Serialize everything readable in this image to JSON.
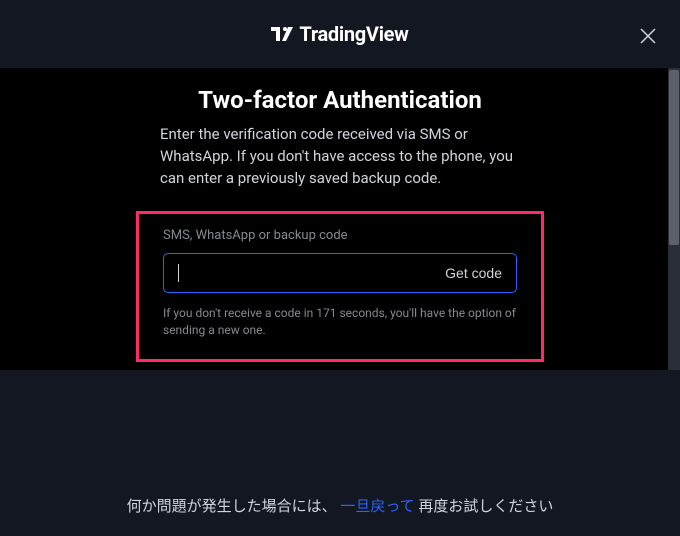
{
  "header": {
    "brand_name": "TradingView"
  },
  "dialog": {
    "title": "Two-factor Authentication",
    "description": "Enter the verification code received via SMS or WhatsApp. If you don't have access to the phone, you can enter a previously saved backup code.",
    "input_label": "SMS, WhatsApp or backup code",
    "input_value": "",
    "get_code_label": "Get code",
    "hint": "If you don't receive a code in 171 seconds, you'll have the option of sending a new one."
  },
  "footer": {
    "prefix": "何か問題が発生した場合には、",
    "link": "一旦戻って",
    "suffix": "再度お試しください"
  }
}
